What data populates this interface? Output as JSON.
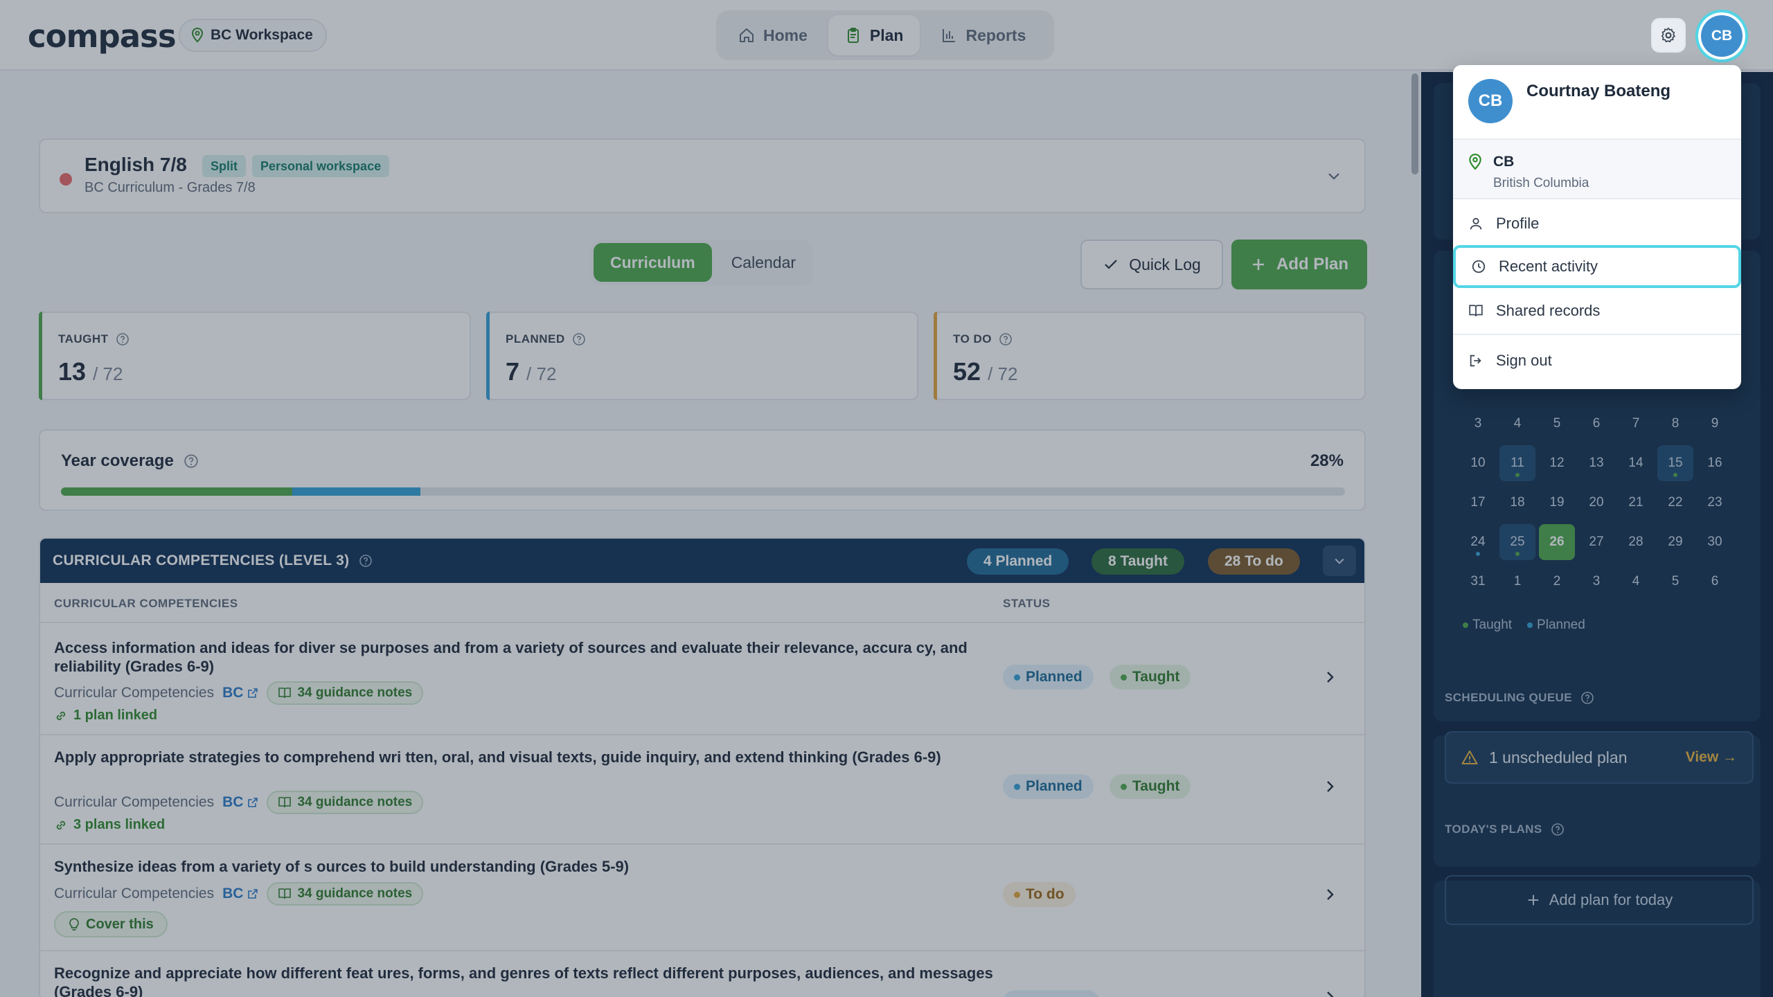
{
  "app": {
    "logo": "compass",
    "workspace": "BC Workspace"
  },
  "nav": {
    "items": [
      {
        "label": "Home",
        "icon": "home-icon"
      },
      {
        "label": "Plan",
        "icon": "clipboard-icon",
        "active": true
      },
      {
        "label": "Reports",
        "icon": "bar-chart-icon"
      }
    ]
  },
  "user": {
    "initials": "CB",
    "name": "Courtnay Boateng",
    "location_code": "CB",
    "location_name": "British Columbia"
  },
  "user_menu": {
    "items": [
      {
        "label": "Profile",
        "icon": "user-icon"
      },
      {
        "label": "Recent activity",
        "icon": "clock-icon",
        "active": true
      },
      {
        "label": "Shared records",
        "icon": "book-icon"
      },
      {
        "label": "Sign out",
        "icon": "sign-out-icon"
      }
    ]
  },
  "course": {
    "title": "English 7/8",
    "tags": [
      "Split",
      "Personal workspace"
    ],
    "subtitle": "BC Curriculum - Grades 7/8"
  },
  "view_toggle": {
    "options": [
      "Curriculum",
      "Calendar"
    ],
    "selected": "Curriculum"
  },
  "actions": {
    "quick_log": "Quick Log",
    "add_plan": "Add Plan"
  },
  "stats": [
    {
      "label": "TAUGHT",
      "value": "13",
      "total": "/ 72",
      "color": "#4ea84a"
    },
    {
      "label": "PLANNED",
      "value": "7",
      "total": "/ 72",
      "color": "#33a0d6"
    },
    {
      "label": "TO DO",
      "value": "52",
      "total": "/ 72",
      "color": "#e2a53a"
    }
  ],
  "coverage": {
    "title": "Year coverage",
    "percent_label": "28%",
    "taught_fraction": 0.18,
    "planned_fraction": 0.1
  },
  "competencies": {
    "title": "CURRICULAR COMPETENCIES (LEVEL 3)",
    "planned_pill": "4 Planned",
    "taught_pill": "8 Taught",
    "todo_pill": "28 To do",
    "col_competency": "CURRICULAR COMPETENCIES",
    "col_status": "STATUS",
    "rows": [
      {
        "title": "Access information and ideas for diver se purposes and from a variety of sources and evaluate their relevance, accura cy, and reliability (Grades 6-9)",
        "category": "Curricular Competencies",
        "bc": "BC",
        "notes": "34 guidance notes",
        "linked": "1 plan linked",
        "status": [
          "Planned",
          "Taught"
        ]
      },
      {
        "title": "Apply appropriate strategies to comprehend wri tten, oral, and visual texts, guide inquiry, and extend thinking (Grades 6-9)",
        "category": "Curricular Competencies",
        "bc": "BC",
        "notes": "34 guidance notes",
        "linked": "3 plans linked",
        "status": [
          "Planned",
          "Taught"
        ]
      },
      {
        "title": "Synthesize ideas from a variety of s ources to build understanding (Grades 5-9)",
        "category": "Curricular Competencies",
        "bc": "BC",
        "notes": "34 guidance notes",
        "cover": "Cover this",
        "status": [
          "To do"
        ]
      },
      {
        "title": "Recognize and appreciate how different feat ures, forms, and genres of texts reflect different purposes, audiences, and messages (Grades 6-9)"
      }
    ]
  },
  "calendar": {
    "days": [
      "3",
      "4",
      "5",
      "6",
      "7",
      "8",
      "9",
      "10",
      "11",
      "12",
      "13",
      "14",
      "15",
      "16",
      "17",
      "18",
      "19",
      "20",
      "21",
      "22",
      "23",
      "24",
      "25",
      "26",
      "27",
      "28",
      "29",
      "30",
      "31",
      "1",
      "2",
      "3",
      "4",
      "5",
      "6"
    ],
    "legend_taught": "Taught",
    "legend_planned": "Planned"
  },
  "sidebar": {
    "queue_label": "SCHEDULING QUEUE",
    "queue_text": "1 unscheduled plan",
    "queue_view": "View →",
    "today_label": "TODAY'S PLANS",
    "add_today": "Add plan for today"
  },
  "colors": {
    "accent_green": "#4ea84a",
    "accent_blue": "#33a0d6",
    "accent_orange": "#e2a53a",
    "navy": "#0f2f56",
    "focus_ring": "#53d6e6"
  }
}
